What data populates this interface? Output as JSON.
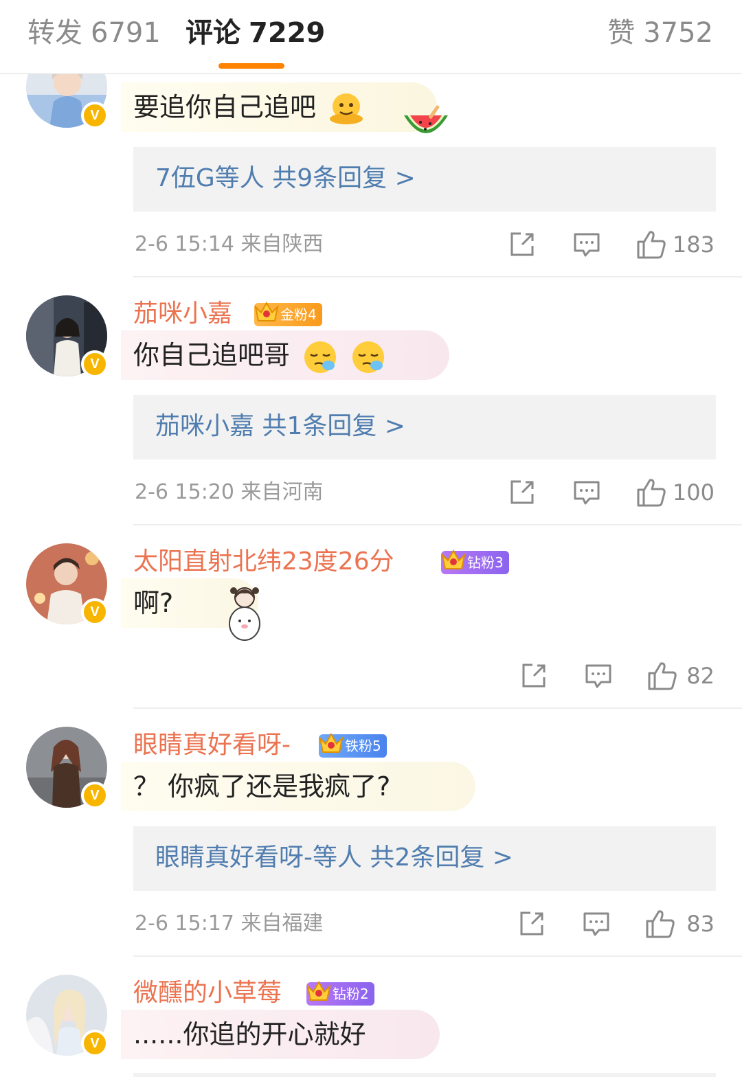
{
  "tabs": {
    "repost_label": "转发",
    "repost_count": "6791",
    "comments_label": "评论",
    "comments_count": "7229",
    "likes_label": "赞",
    "likes_count": "3752",
    "active_color": "#ff8200"
  },
  "colors": {
    "username": "#eb7350",
    "reply_link": "#507daf",
    "verified_badge": "#f7b500"
  },
  "comments": [
    {
      "username": "",
      "text": "要追你自己追吧",
      "emojis": [
        "melting-face-emoji",
        "watermelon-sticker"
      ],
      "reply_summary": "7伍G等人  共9条回复 >",
      "meta": "2-6 15:14  来自陕西",
      "likes": "183",
      "verified": "V"
    },
    {
      "username": "茄咪小嘉",
      "fan_badge": "金粉4",
      "text": "你自己追吧哥",
      "emojis": [
        "sleepy-face-emoji",
        "sleepy-face-emoji"
      ],
      "reply_summary": "茄咪小嘉  共1条回复 >",
      "meta": "2-6 15:20  来自河南",
      "likes": "100",
      "verified": "V"
    },
    {
      "username": "太阳直射北纬23度26分",
      "fan_badge": "钻粉3",
      "text": "啊?",
      "emojis": [
        "girl-with-cat-sticker"
      ],
      "meta": "",
      "likes": "82",
      "verified": "V"
    },
    {
      "username": "眼睛真好看呀-",
      "fan_badge": "铁粉5",
      "text": "？ 你疯了还是我疯了?",
      "reply_summary": "眼睛真好看呀-等人  共2条回复 >",
      "meta": "2-6 15:17  来自福建",
      "likes": "83",
      "verified": "V"
    },
    {
      "username": "微醺的小草莓",
      "fan_badge": "钻粉2",
      "text": "......你追的开心就好",
      "verified": "V"
    }
  ]
}
